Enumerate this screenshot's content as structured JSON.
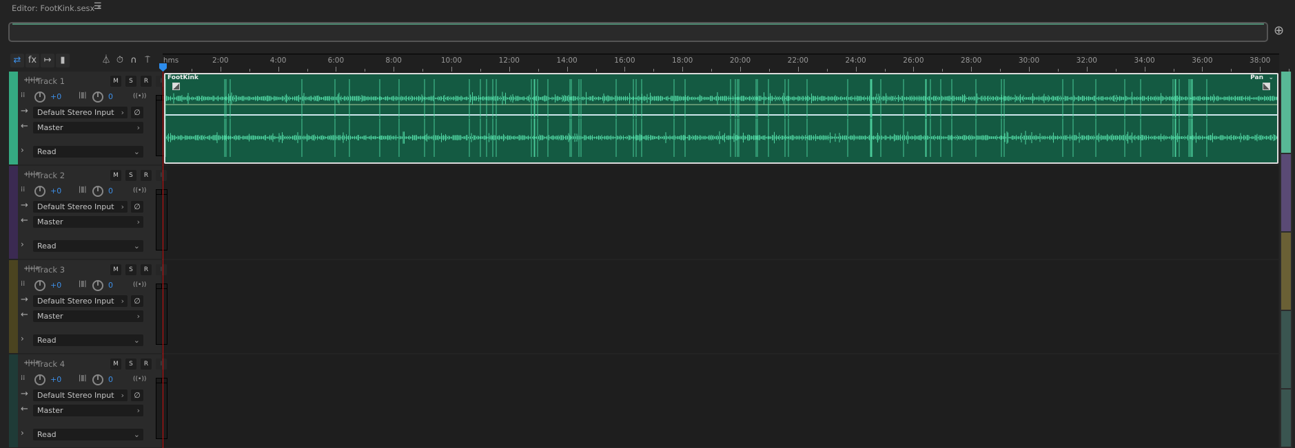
{
  "editor": {
    "tab_title": "Editor: FootKink.sesx *"
  },
  "toolbar": {
    "tools": [
      {
        "name": "io-toggle",
        "icon": "⇄"
      },
      {
        "name": "effects",
        "icon": "fx"
      },
      {
        "name": "sends",
        "icon": "↦"
      },
      {
        "name": "eq",
        "icon": "▮"
      }
    ],
    "right_tools": [
      {
        "name": "metronome",
        "icon": "⏃"
      },
      {
        "name": "time-stretch",
        "icon": "⏱"
      },
      {
        "name": "snap",
        "icon": "∩"
      },
      {
        "name": "marker",
        "icon": "⍑"
      }
    ]
  },
  "ruler": {
    "unit_label": "hms",
    "labels": [
      "2:00",
      "4:00",
      "6:00",
      "8:00",
      "10:00",
      "12:00",
      "14:00",
      "16:00",
      "18:00",
      "20:00",
      "22:00",
      "24:00",
      "26:00",
      "28:00",
      "30:00",
      "32:00",
      "34:00",
      "36:00",
      "38:00"
    ]
  },
  "tracks": [
    {
      "name": "Track 1",
      "color": "#35aa82",
      "volume": "+0",
      "pan": "0",
      "input": "Default Stereo Input",
      "output": "Master",
      "automation": "Read"
    },
    {
      "name": "Track 2",
      "color": "#3b2a52",
      "volume": "+0",
      "pan": "0",
      "input": "Default Stereo Input",
      "output": "Master",
      "automation": "Read"
    },
    {
      "name": "Track 3",
      "color": "#4b4420",
      "volume": "+0",
      "pan": "0",
      "input": "Default Stereo Input",
      "output": "Master",
      "automation": "Read"
    },
    {
      "name": "Track 4",
      "color": "#1f3b37",
      "volume": "+0",
      "pan": "0",
      "input": "Default Stereo Input",
      "output": "Master",
      "automation": "Read"
    }
  ],
  "buttons": {
    "mute": "M",
    "solo": "S",
    "record": "R",
    "monitor": "I"
  },
  "clip": {
    "name": "FootKink",
    "envelope": "Pan",
    "waveform_color": "#4fd6a2",
    "background": "#145a42"
  }
}
